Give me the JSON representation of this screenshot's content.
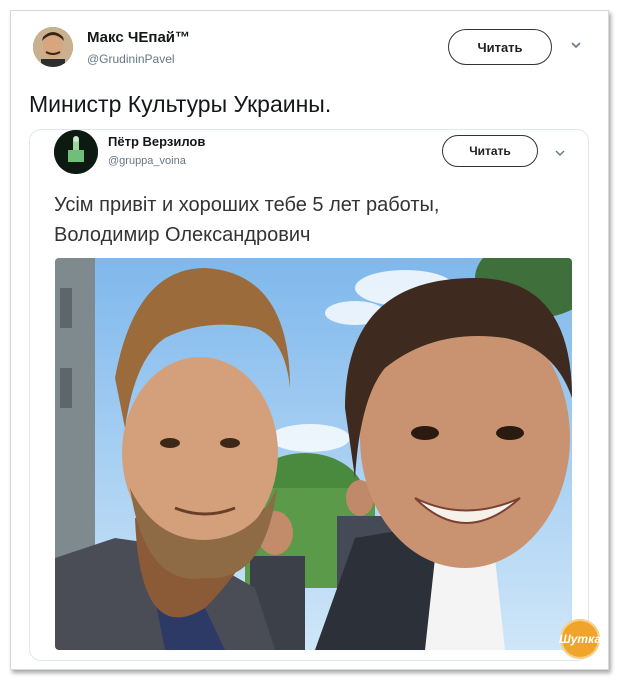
{
  "outer_tweet": {
    "author_name": "Макс ЧЕпай™",
    "author_handle": "@GrudininPavel",
    "follow_label": "Читать",
    "text": "Министр Культуры Украины."
  },
  "quoted_tweet": {
    "author_name": "Пётр Верзилов",
    "author_handle": "@gruppa_voina",
    "follow_label": "Читать",
    "text_line1": "Усім привіт и хороших тебе 5 лет работы,",
    "text_line2": "Володимир Олександрович"
  },
  "icons": {
    "outer_more": "chevron-down-icon",
    "quoted_more": "chevron-down-icon"
  },
  "watermark": {
    "text": "Шутка"
  },
  "colors": {
    "text": "#14171a",
    "secondary": "#657786",
    "sky": "#8ec3ef",
    "watermark": "#f0a52a"
  }
}
